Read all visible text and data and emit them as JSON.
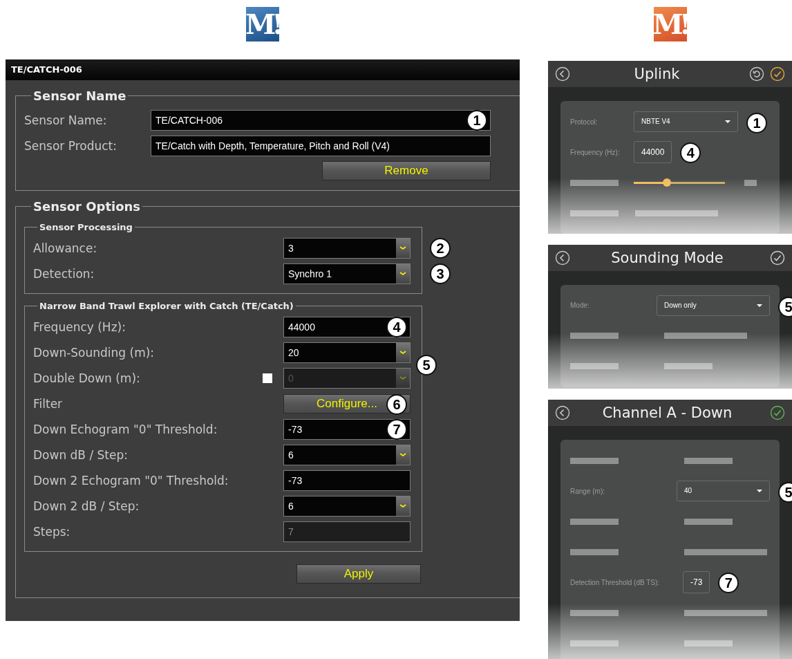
{
  "desktop_app": {
    "logo": "M!",
    "window_title": "TE/CATCH-006",
    "sensor_name": {
      "title": "Sensor Name",
      "rows": [
        {
          "label": "Sensor Name:",
          "kind": "text",
          "value": "TE/CATCH-006",
          "callout": "1"
        },
        {
          "label": "Sensor Product:",
          "kind": "text",
          "value": "TE/Catch with Depth, Temperature, Pitch and Roll (V4)"
        }
      ],
      "button": "Remove"
    },
    "sensor_options": {
      "title": "Sensor Options",
      "groups": [
        {
          "title": "Sensor Processing",
          "rows": [
            {
              "label": "Allowance:",
              "kind": "dropdown",
              "value": "3",
              "callout": "2"
            },
            {
              "label": "Detection:",
              "kind": "dropdown",
              "value": "Synchro 1",
              "callout": "3"
            }
          ]
        },
        {
          "title": "Narrow Band Trawl Explorer with Catch (TE/Catch)",
          "rows": [
            {
              "label": "Frequency (Hz):",
              "kind": "text",
              "value": "44000",
              "callout": "4"
            },
            {
              "label": "Down-Sounding (m):",
              "kind": "dropdown",
              "value": "20",
              "callout": "5"
            },
            {
              "label": "Double Down (m):",
              "kind": "check-dropdown",
              "checked": false,
              "disabled": true,
              "value": "0"
            },
            {
              "label": "Filter",
              "kind": "button",
              "value": "Configure...",
              "callout": "6"
            },
            {
              "label": "Down Echogram \"0\" Threshold:",
              "kind": "text",
              "value": "-73",
              "callout": "7"
            },
            {
              "label": "Down dB / Step:",
              "kind": "dropdown",
              "value": "6"
            },
            {
              "label": "Down 2 Echogram \"0\" Threshold:",
              "kind": "text",
              "value": "-73"
            },
            {
              "label": "Down 2 dB / Step:",
              "kind": "dropdown",
              "value": "6"
            },
            {
              "label": "Steps:",
              "kind": "readonly",
              "value": "7"
            }
          ]
        }
      ],
      "button": "Apply"
    }
  },
  "mobile_app": {
    "logo": "M!",
    "panels": [
      {
        "title": "Uplink",
        "header_icons": [
          {
            "kind": "back"
          },
          {
            "kind": "reset"
          },
          {
            "kind": "confirm",
            "color": "#e6a93a"
          }
        ],
        "rows": [
          {
            "kind": "dropdown",
            "label": "Protocol:",
            "value": "NBTE V4",
            "callout": "1"
          },
          {
            "kind": "field",
            "label": "Frequency (Hz):",
            "value": "44000",
            "callout": "4"
          },
          {
            "kind": "slider",
            "level": 0.36
          },
          {
            "kind": "placeholder"
          }
        ]
      },
      {
        "title": "Sounding Mode",
        "header_icons": [
          {
            "kind": "back"
          },
          {
            "kind": "confirm",
            "color": "#d0d0d0"
          }
        ],
        "rows": [
          {
            "kind": "dropdown",
            "label": "Mode:",
            "value": "Down only",
            "callout": "5"
          },
          {
            "kind": "placeholder"
          },
          {
            "kind": "placeholder"
          }
        ]
      },
      {
        "title": "Channel A - Down",
        "header_icons": [
          {
            "kind": "back"
          },
          {
            "kind": "confirm",
            "color": "#5fb84a"
          }
        ],
        "rows": [
          {
            "kind": "placeholder"
          },
          {
            "kind": "dropdown",
            "label": "Range (m):",
            "value": "40",
            "callout": "5"
          },
          {
            "kind": "placeholder"
          },
          {
            "kind": "placeholder"
          },
          {
            "kind": "field",
            "label": "Detection Threshold (dB TS):",
            "value": "-73",
            "callout": "7"
          },
          {
            "kind": "placeholder"
          },
          {
            "kind": "placeholder"
          }
        ]
      }
    ]
  }
}
